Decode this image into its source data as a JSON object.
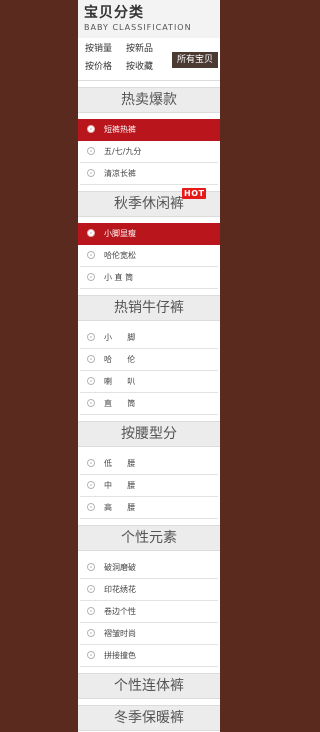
{
  "header": {
    "title": "宝贝分类",
    "subtitle": "BABY CLASSIFICATION"
  },
  "sort": {
    "by_sales": "按销量",
    "by_new": "按新品",
    "by_price": "按价格",
    "by_favorites": "按收藏",
    "all_items": "所有宝贝"
  },
  "sections": [
    {
      "title": "热卖爆款",
      "items": [
        "短裤热裤",
        "五/七/九分",
        "清凉长裤"
      ]
    },
    {
      "title": "秋季休闲裤",
      "badge": "HOT",
      "items": [
        "小脚显瘦",
        "哈伦宽松",
        "小 直 筒"
      ]
    },
    {
      "title": "热销牛仔裤",
      "items": [
        "小      脚",
        "哈      伦",
        "喇      叭",
        "直      筒"
      ]
    },
    {
      "title": "按腰型分",
      "items": [
        "低      腰",
        "中      腰",
        "高      腰"
      ]
    },
    {
      "title": "个性元素",
      "items": [
        "破洞磨破",
        "印花绣花",
        "卷边个性",
        "褶皱时尚",
        "拼接撞色"
      ]
    },
    {
      "title": "个性连体裤",
      "items": []
    },
    {
      "title": "冬季保暖裤",
      "items": []
    }
  ],
  "active_items": [
    "短裤热裤",
    "小脚显瘦"
  ],
  "colors": {
    "background": "#5a2a1f",
    "accent": "#b8151c",
    "hot_badge": "#e61a1a"
  }
}
